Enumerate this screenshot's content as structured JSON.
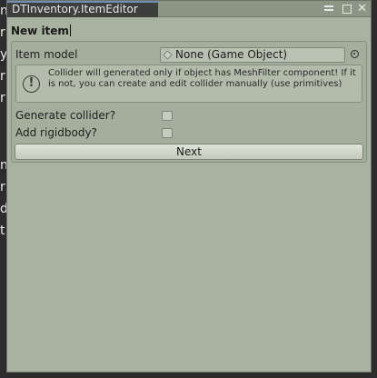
{
  "background_fragments": [
    "n",
    "r",
    "y",
    "r",
    "r",
    "n",
    "r",
    "d",
    "t"
  ],
  "window": {
    "tab_title": "DTInventory.ItemEditor",
    "icons": [
      "menu-icon",
      "maximize-icon",
      "close-icon"
    ]
  },
  "editor": {
    "heading": "New item",
    "item_model_label": "Item model",
    "item_model_value": "None (Game Object)",
    "help_text": "Collider will generated only if object has MeshFilter component! If it is not, you can create and edit collider manually (use primitives)",
    "help_icon": "!",
    "generate_collider_label": "Generate collider?",
    "generate_collider_checked": false,
    "add_rigidbody_label": "Add rigidbody?",
    "add_rigidbody_checked": false,
    "next_label": "Next"
  },
  "colors": {
    "panel_bg": "#a8b2a0",
    "tab_bg": "#3d3f3d",
    "tab_accent": "#6f8fb8"
  }
}
